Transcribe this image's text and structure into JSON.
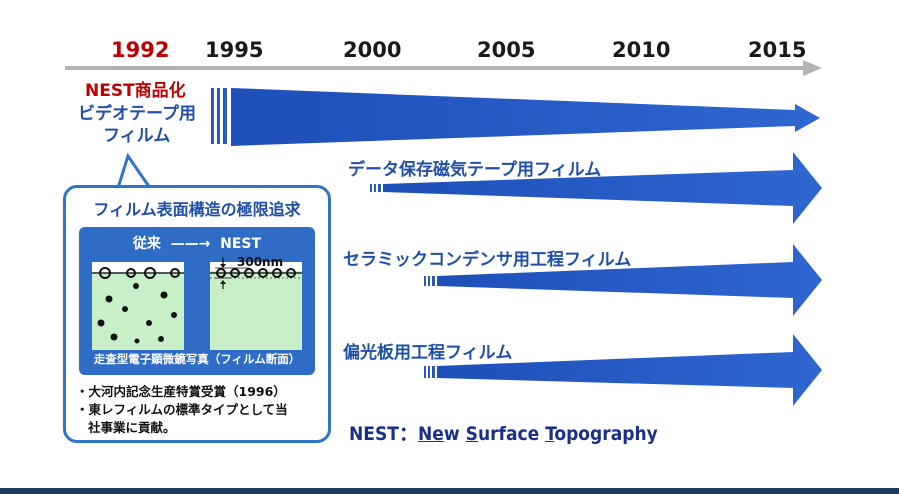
{
  "timeline": {
    "years": [
      "1992",
      "1995",
      "2000",
      "2005",
      "2010",
      "2015"
    ],
    "highlight_year": "1992"
  },
  "milestone": {
    "title": "NEST商品化",
    "product": "ビデオテープ用フィルム",
    "product_line1": "ビデオテープ用",
    "product_line2": "フィルム"
  },
  "applications": [
    {
      "label": "データ保存磁気テープ用フィルム"
    },
    {
      "label": "セラミックコンデンサ用工程フィルム"
    },
    {
      "label": "偏光板用工程フィルム"
    }
  ],
  "callout": {
    "title": "フィルム表面構造の極限追求",
    "comparison_from": "従来",
    "comparison_to": "NEST",
    "scale_label": "300nm",
    "caption": "走査型電子顕微鏡写真（フィルム断面）",
    "bullets": [
      "大河内記念生産特賞受賞（1996）",
      "東レフィルムの標準タイプとして当社事業に貢献。"
    ],
    "bullet2_line1": "東レフィルムの標準タイプとして当",
    "bullet2_line2": "社事業に貢献。"
  },
  "definition": {
    "prefix": "NEST：",
    "w1_ul": "Ne",
    "w1_rest": "w ",
    "w2_ul": "S",
    "w2_rest": "urface ",
    "w3_ul": "T",
    "w3_rest": "opography"
  },
  "colors": {
    "arrow_blue": "#2e5fc4",
    "axis_gray": "#b0b0b0",
    "highlight_red": "#c00000",
    "label_blue": "#1f4fa8"
  }
}
